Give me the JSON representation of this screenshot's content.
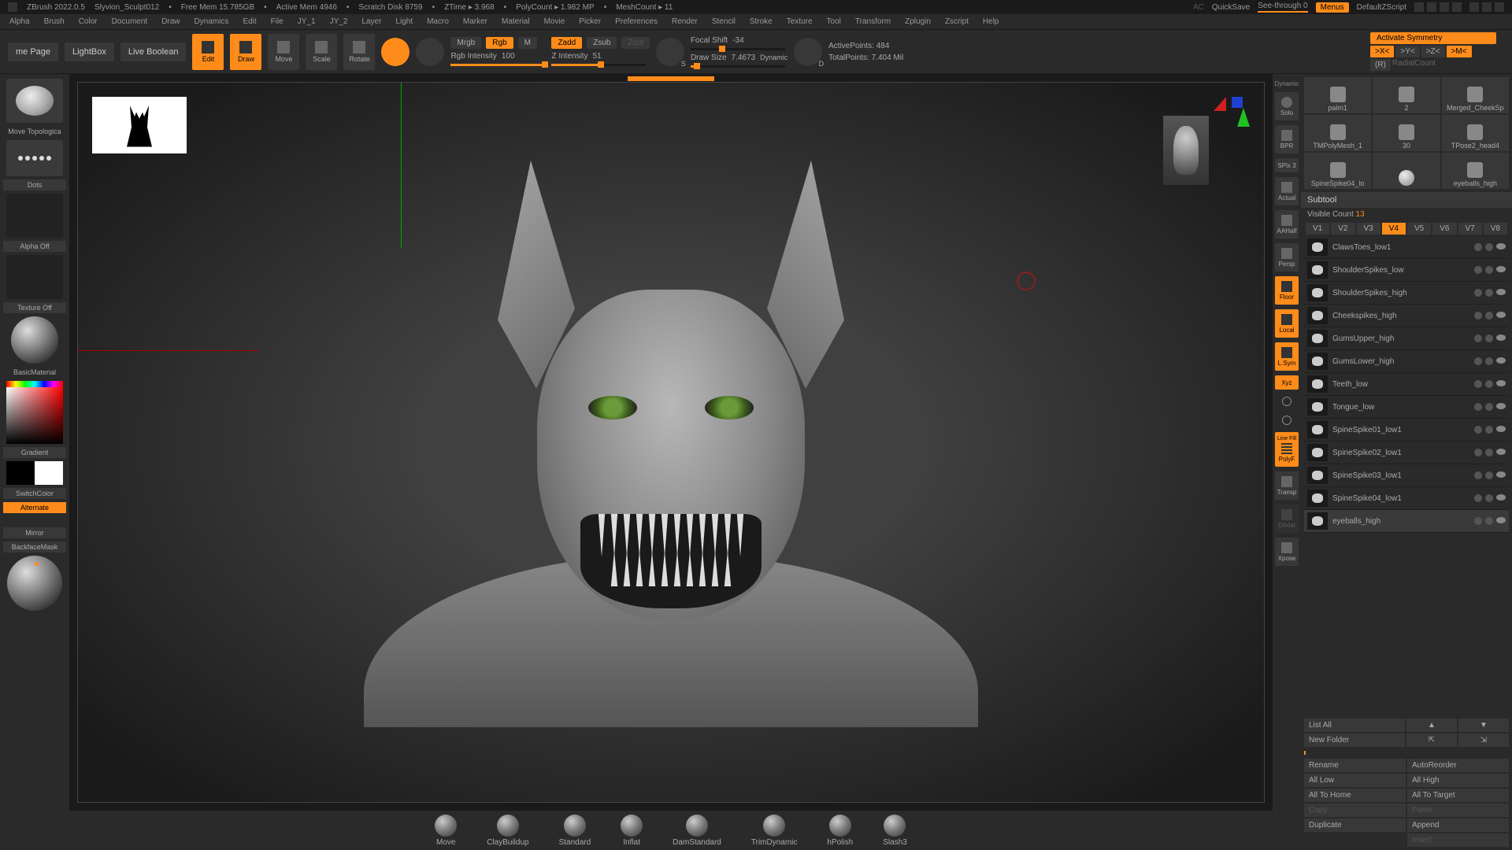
{
  "titlebar": {
    "app": "ZBrush 2022.0.5",
    "file": "Slyvion_Sculpt012",
    "stats": [
      "Free Mem 15.785GB",
      "Active Mem 4946",
      "Scratch Disk 8759",
      "ZTime ▸ 3.968",
      "PolyCount ▸ 1.982 MP",
      "MeshCount ▸ 11"
    ],
    "right": {
      "ac": "AC",
      "quicksave": "QuickSave",
      "seethrough": "See-through  0",
      "menus": "Menus",
      "zscript": "DefaultZScript"
    }
  },
  "menubar": [
    "Alpha",
    "Brush",
    "Color",
    "Document",
    "Draw",
    "Dynamics",
    "Edit",
    "File",
    "JY_1",
    "JY_2",
    "Layer",
    "Light",
    "Macro",
    "Marker",
    "Material",
    "Movie",
    "Picker",
    "Preferences",
    "Render",
    "Stencil",
    "Stroke",
    "Texture",
    "Tool",
    "Transform",
    "Zplugin",
    "Zscript",
    "Help"
  ],
  "topshelf": {
    "home": "me Page",
    "lightbox": "LightBox",
    "livebool": "Live Boolean",
    "gizmos": [
      "Edit",
      "Draw",
      "Move",
      "Scale",
      "Rotate"
    ],
    "mrgb": "Mrgb",
    "rgb": "Rgb",
    "m": "M",
    "rgb_intensity_label": "Rgb Intensity",
    "rgb_intensity": "100",
    "zadd": "Zadd",
    "zsub": "Zsub",
    "zcut": "Zcut",
    "z_intensity_label": "Z Intensity",
    "z_intensity": "51",
    "focal_label": "Focal Shift",
    "focal": "-34",
    "draw_label": "Draw Size",
    "draw": "7.4673",
    "dynamic": "Dynamic",
    "activepoints_label": "ActivePoints:",
    "activepoints": "484",
    "totalpoints_label": "TotalPoints:",
    "totalpoints": "7.404 Mil",
    "activate_sym": "Activate Symmetry",
    "sym_btns": [
      ">X<",
      ">Y<",
      ">Z<",
      ">M<"
    ],
    "r_label": "(R)",
    "radial": "RadialCount"
  },
  "left": {
    "brush": "Move Topologica",
    "stroke": "Dots",
    "alpha": "Alpha Off",
    "texture": "Texture Off",
    "material": "BasicMaterial",
    "gradient": "Gradient",
    "switch": "SwitchColor",
    "alternate": "Alternate",
    "mirror": "Mirror",
    "backface": "BackfaceMask"
  },
  "vp_side": {
    "dyn": "Dynamic",
    "solo": "Solo",
    "bpr": "BPR",
    "spix": "SPix 3",
    "actual": "Actual",
    "aahalf": "AAHalf",
    "persp": "Persp",
    "floor": "Floor",
    "local": "Local",
    "lsym": "L.Sym",
    "xyz": "Xyz",
    "polyf": "PolyF",
    "linefill": "Line Fill",
    "transp": "Transp",
    "ghost": "Ghost",
    "xpose": "Xpose"
  },
  "brushes": [
    "Move",
    "ClayBuildup",
    "Standard",
    "Inflat",
    "DamStandard",
    "TrimDynamic",
    "hPolish",
    "Slash3"
  ],
  "right": {
    "tools": [
      {
        "label": "palm1",
        "num": ""
      },
      {
        "label": "2",
        "num": ""
      },
      {
        "label": "Merged_CheekSp",
        "num": ""
      },
      {
        "label": "TMPolyMesh_1",
        "num": ""
      },
      {
        "label": "30",
        "num": ""
      },
      {
        "label": "TPose2_head4",
        "num": ""
      },
      {
        "label": "SpineSpike04_lo",
        "num": ""
      },
      {
        "label": "",
        "num": ""
      },
      {
        "label": "eyeballs_high",
        "num": ""
      }
    ],
    "subtool_header": "Subtool",
    "visible_count_label": "Visible Count",
    "visible_count": "13",
    "vbuttons": [
      "V1",
      "V2",
      "V3",
      "V4",
      "V5",
      "V6",
      "V7",
      "V8"
    ],
    "v_active": "V4",
    "subtools": [
      "ClawsToes_low1",
      "ShoulderSpikes_low",
      "ShoulderSpikes_high",
      "Cheekspikes_high",
      "GumsUpper_high",
      "GumsLower_high",
      "Teeth_low",
      "Tongue_low",
      "SpineSpike01_low1",
      "SpineSpike02_low1",
      "SpineSpike03_low1",
      "SpineSpike04_low1",
      "eyeballs_high"
    ],
    "selected_subtool": "eyeballs_high",
    "actions": {
      "listall": "List All",
      "up": "▲",
      "dn": "▼",
      "newfolder": "New Folder",
      "upo": "⇱",
      "dno": "⇲",
      "rename": "Rename",
      "autoreorder": "AutoReorder",
      "alllow": "All Low",
      "allhigh": "All High",
      "alltohome": "All To Home",
      "alltotarget": "All To Target",
      "copy": "Copy",
      "paste": "Paste",
      "duplicate": "Duplicate",
      "append": "Append",
      "insert": "Insert"
    }
  }
}
